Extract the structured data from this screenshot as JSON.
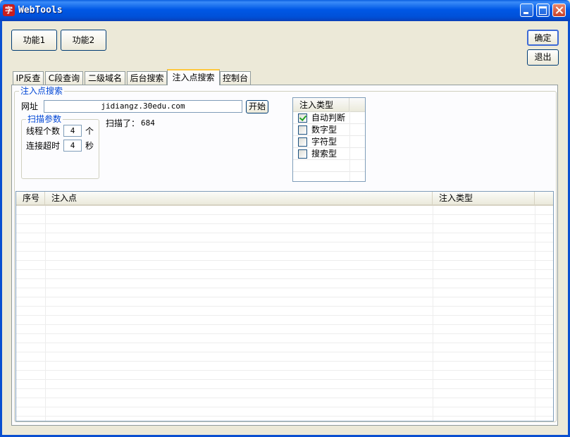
{
  "window": {
    "title": "WebTools",
    "app_icon_char": "字"
  },
  "toolbar": {
    "func1_label": "功能1",
    "func2_label": "功能2",
    "ok_label": "确定",
    "exit_label": "退出"
  },
  "tabs": [
    {
      "label": "IP反查"
    },
    {
      "label": "C段查询"
    },
    {
      "label": "二级域名"
    },
    {
      "label": "后台搜索"
    },
    {
      "label": "注入点搜索",
      "active": true
    },
    {
      "label": "控制台"
    }
  ],
  "injection_search": {
    "group_title": "注入点搜索",
    "url_label": "网址",
    "url_value": "jidiangz.30edu.com",
    "start_label": "开始",
    "scanned_label": "扫描了：",
    "scanned_count": "684",
    "scan_params": {
      "title": "扫描参数",
      "threads_label": "线程个数",
      "threads_value": "4",
      "threads_unit": "个",
      "timeout_label": "连接超时",
      "timeout_value": "4",
      "timeout_unit": "秒"
    },
    "injection_types": {
      "header": "注入类型",
      "options": [
        {
          "label": "自动判断",
          "checked": true
        },
        {
          "label": "数字型",
          "checked": false
        },
        {
          "label": "字符型",
          "checked": false
        },
        {
          "label": "搜索型",
          "checked": false
        }
      ]
    }
  },
  "results_table": {
    "columns": [
      "序号",
      "注入点",
      "注入类型"
    ],
    "rows": []
  }
}
